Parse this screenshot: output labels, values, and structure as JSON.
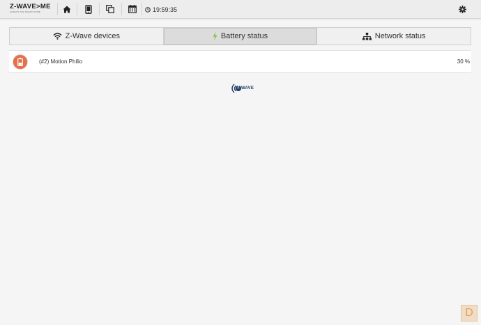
{
  "header": {
    "logo_main": "Z-WAVE>ME",
    "logo_sub": "ALWAYS THE SMART HOME",
    "clock": "19:59:35",
    "buttons": [
      {
        "icon": "home-icon"
      },
      {
        "icon": "tablet-icon"
      },
      {
        "icon": "copy-icon"
      },
      {
        "icon": "calendar-icon"
      }
    ],
    "settings_icon": "gear-icon"
  },
  "tabs": [
    {
      "label": "Z-Wave devices",
      "icon": "wifi-icon",
      "active": false
    },
    {
      "label": "Battery status",
      "icon": "bolt-icon",
      "active": true
    },
    {
      "label": "Network status",
      "icon": "sitemap-icon",
      "active": false
    }
  ],
  "devices": [
    {
      "name": "(#2) Motion Philio",
      "level": "30 %",
      "level_value": 30,
      "icon": "battery-icon",
      "icon_color": "#e5704a"
    }
  ],
  "footer": {
    "zwave_text": "WAVE",
    "zwave_badge": "Z"
  },
  "debug_button": "D",
  "colors": {
    "accent_battery": "#8bc34a",
    "device_icon_bg": "#e5704a",
    "zwave_blue": "#1f3d66"
  }
}
